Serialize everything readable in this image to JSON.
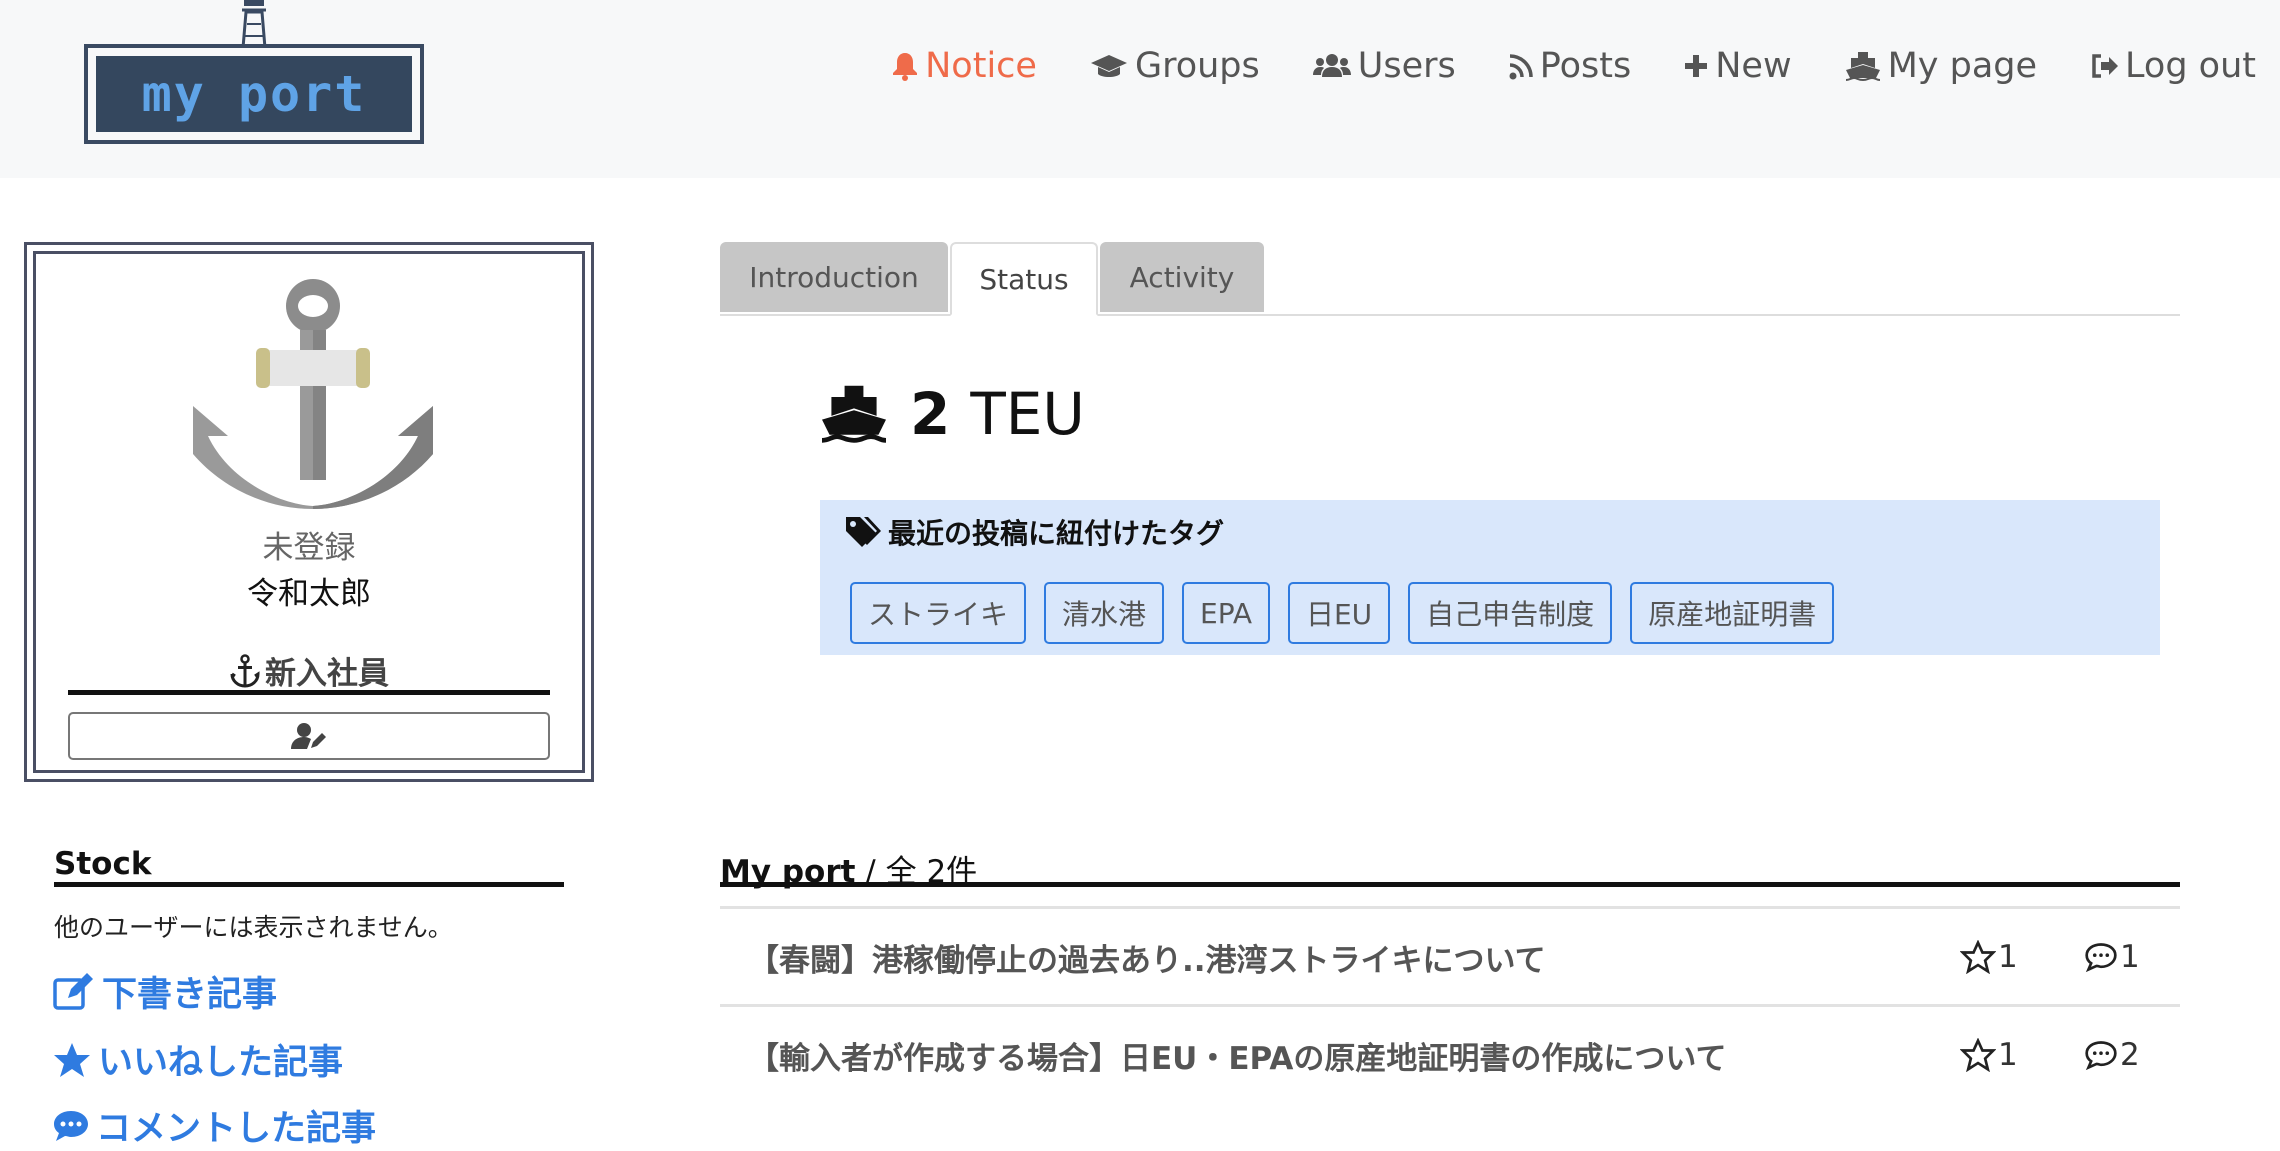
{
  "header": {
    "logo_text": "my port",
    "nav": [
      {
        "label": "Notice",
        "icon": "bell-icon",
        "active": true
      },
      {
        "label": "Groups",
        "icon": "graduation-cap-icon"
      },
      {
        "label": "Users",
        "icon": "users-icon"
      },
      {
        "label": "Posts",
        "icon": "rss-icon"
      },
      {
        "label": "New",
        "icon": "plus-icon"
      },
      {
        "label": "My page",
        "icon": "ship-icon"
      },
      {
        "label": "Log out",
        "icon": "sign-out-icon"
      }
    ]
  },
  "profile": {
    "status": "未登録",
    "name": "令和太郎",
    "role": "新入社員"
  },
  "stock": {
    "title": "Stock",
    "note": "他のユーザーには表示されません。",
    "links": [
      "下書き記事",
      "いいねした記事",
      "コメントした記事"
    ]
  },
  "tabs": [
    "Introduction",
    "Status",
    "Activity"
  ],
  "active_tab": "Status",
  "status": {
    "teu_value": "2",
    "teu_unit": "TEU",
    "tags_title": "最近の投稿に紐付けたタグ",
    "tags": [
      "ストライキ",
      "清水港",
      "EPA",
      "日EU",
      "自己申告制度",
      "原産地証明書"
    ]
  },
  "myport": {
    "title": "My port",
    "count_label": " / 全 2件",
    "posts": [
      {
        "title": "【春闘】港稼働停止の過去あり..港湾ストライキについて",
        "likes": "1",
        "comments": "1"
      },
      {
        "title": "【輸入者が作成する場合】日EU・EPAの原産地証明書の作成について",
        "likes": "1",
        "comments": "2"
      }
    ]
  },
  "colors": {
    "accent_notice": "#ef6b4a",
    "link_blue": "#2f7be0",
    "tag_background": "#d9e7fb",
    "logo_navy": "#34475e"
  }
}
